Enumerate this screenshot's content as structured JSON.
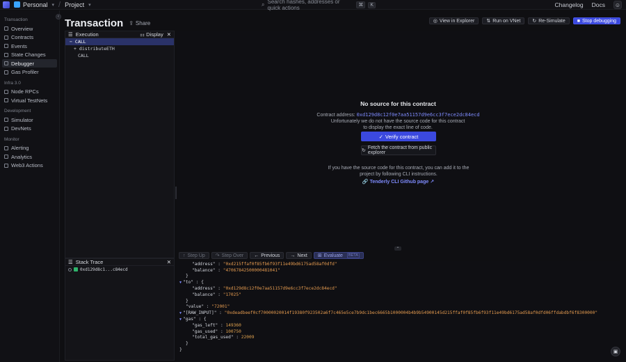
{
  "topbar": {
    "workspace": "Personal",
    "project": "Project",
    "search_placeholder": "Search hashes, addresses or quick actions",
    "kbd_cmd": "⌘",
    "kbd_key": "K",
    "changelog": "Changelog",
    "docs": "Docs"
  },
  "sidebar": {
    "sections": [
      {
        "title": "Transaction",
        "items": [
          "Overview",
          "Contracts",
          "Events",
          "State Changes",
          "Debugger",
          "Gas Profiler"
        ]
      },
      {
        "title": "Infra 3.0",
        "items": [
          "Node RPCs",
          "Virtual TestNets"
        ]
      },
      {
        "title": "Development",
        "items": [
          "Simulator",
          "DevNets"
        ]
      },
      {
        "title": "Monitor",
        "items": [
          "Alerting",
          "Analytics",
          "Web3 Actions"
        ]
      }
    ],
    "active": "Debugger"
  },
  "header": {
    "title": "Transaction",
    "share": "Share",
    "actions": {
      "explorer": "View in Explorer",
      "vnet": "Run on VNet",
      "resimulate": "Re-Simulate",
      "stop": "Stop debugging"
    }
  },
  "execution": {
    "title": "Execution",
    "display": "Display",
    "rows": [
      {
        "label": "CALL",
        "indent": 0,
        "selected": true,
        "toggle": "−"
      },
      {
        "label": "distributeETH",
        "indent": 1,
        "selected": false,
        "toggle": "+"
      },
      {
        "label": "CALL",
        "indent": 2,
        "selected": false,
        "toggle": ""
      }
    ]
  },
  "source": {
    "title": "No source for this contract",
    "addr_label": "Contract address:",
    "addr": "0xd129d8c12f0e7aa51157d9e6cc3f7ece2dc84ecd",
    "message": "Unfortunately we do not have the source code for this contract to display the exact line of code.",
    "verify": "Verify contract",
    "fetch": "Fetch the contract from public explorer",
    "cli_message": "If you have the source code for this contract, you can add it to the project by following CLI instructions.",
    "gh_link": "Tenderly CLI Github page"
  },
  "debug": {
    "step_up": "Step Up",
    "step_over": "Step Over",
    "previous": "Previous",
    "next": "Next",
    "evaluate": "Evaluate",
    "evaluate_key": "BETA"
  },
  "stack": {
    "title": "Stack Trace",
    "items": [
      "0xd129d8c1...c84ecd"
    ]
  },
  "code_lines": [
    {
      "indent": 2,
      "parts": [
        [
          "k",
          "\"address\""
        ],
        [
          "k",
          " : "
        ],
        [
          "s",
          "\"0xd215ffaf0f85fb6f93f11e49bd6175ad58af0dfd\""
        ]
      ]
    },
    {
      "indent": 2,
      "parts": [
        [
          "k",
          "\"balance\""
        ],
        [
          "k",
          " : "
        ],
        [
          "s",
          "\"47067842500000481041\""
        ]
      ]
    },
    {
      "indent": 1,
      "parts": [
        [
          "k",
          "}"
        ]
      ]
    },
    {
      "indent": 0,
      "tw": true,
      "parts": [
        [
          "k",
          "\"to\""
        ],
        [
          "k",
          " : {"
        ]
      ]
    },
    {
      "indent": 2,
      "parts": [
        [
          "k",
          "\"address\""
        ],
        [
          "k",
          " : "
        ],
        [
          "s",
          "\"0xd129d8c12f0e7aa51157d9e6cc3f7ece2dc84ecd\""
        ]
      ]
    },
    {
      "indent": 2,
      "parts": [
        [
          "k",
          "\"balance\""
        ],
        [
          "k",
          " : "
        ],
        [
          "s",
          "\"17025\""
        ]
      ]
    },
    {
      "indent": 1,
      "parts": [
        [
          "k",
          "}"
        ]
      ]
    },
    {
      "indent": 1,
      "parts": [
        [
          "k",
          "\"value\""
        ],
        [
          "k",
          " : "
        ],
        [
          "s",
          "\"72001\""
        ]
      ]
    },
    {
      "indent": 0,
      "tw": true,
      "parts": [
        [
          "k",
          "\"[RAW_INPUT]\""
        ],
        [
          "k",
          " : "
        ],
        [
          "s",
          "\"0xdeadbeef0cf70000020014f19380f923502a6f7c465e5ce7b9dc1bec6665b1000004b4b9b54900145d215ffaf0f85fb6f93f11e49bd6175ad58af0dfd06ffdabdbf6f8300000\""
        ]
      ]
    },
    {
      "indent": 0,
      "tw": true,
      "parts": [
        [
          "k",
          "\"gas\""
        ],
        [
          "k",
          " : {"
        ]
      ]
    },
    {
      "indent": 2,
      "parts": [
        [
          "k",
          "\"gas_left\""
        ],
        [
          "k",
          " : "
        ],
        [
          "n",
          "149360"
        ]
      ]
    },
    {
      "indent": 2,
      "parts": [
        [
          "k",
          "\"gas_used\""
        ],
        [
          "k",
          " : "
        ],
        [
          "n",
          "100750"
        ]
      ]
    },
    {
      "indent": 2,
      "parts": [
        [
          "k",
          "\"total_gas_used\""
        ],
        [
          "k",
          " : "
        ],
        [
          "n",
          "22009"
        ]
      ]
    },
    {
      "indent": 1,
      "parts": [
        [
          "k",
          "}"
        ]
      ]
    },
    {
      "indent": 0,
      "parts": [
        [
          "k",
          "}"
        ]
      ]
    }
  ]
}
